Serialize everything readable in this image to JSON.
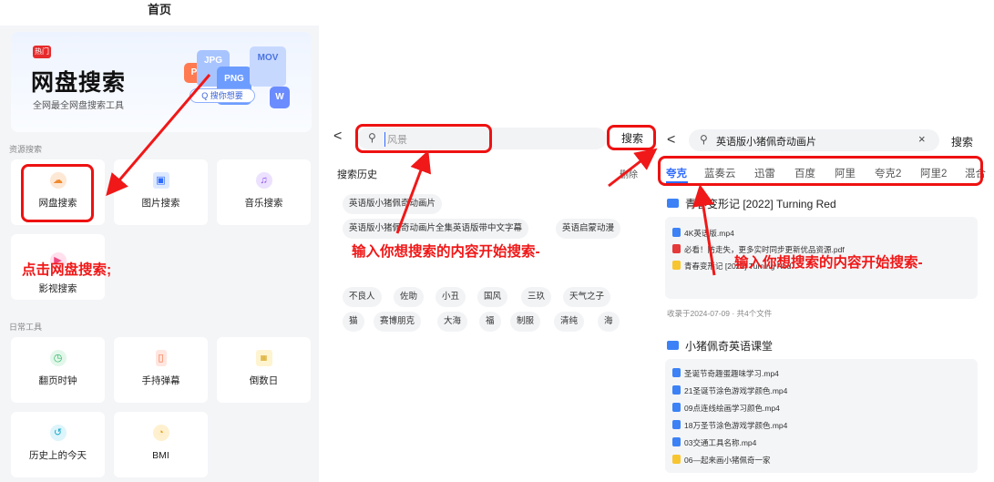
{
  "panel1": {
    "title": "首页",
    "banner": {
      "badge": "热门",
      "title": "网盘搜索",
      "subtitle": "全网最全网盘搜索工具",
      "file_icons": [
        "P",
        "JPG",
        "PNG",
        "MOV",
        "W"
      ],
      "search_chip": "Q 搜你想要"
    },
    "resource_section": "资源搜索",
    "resource_items": [
      {
        "label": "网盘搜索",
        "icon": "cloud-icon"
      },
      {
        "label": "图片搜索",
        "icon": "image-icon"
      },
      {
        "label": "音乐搜索",
        "icon": "music-icon"
      },
      {
        "label": "影视搜索",
        "icon": "video-icon"
      }
    ],
    "tools_section": "日常工具",
    "tool_items": [
      {
        "label": "翻页时钟",
        "icon": "clock-icon"
      },
      {
        "label": "手持弹幕",
        "icon": "phone-icon"
      },
      {
        "label": "倒数日",
        "icon": "calendar-icon"
      },
      {
        "label": "历史上的今天",
        "icon": "history-icon"
      },
      {
        "label": "BMI",
        "icon": "gauge-icon"
      }
    ],
    "annotation": "点击网盘搜索;"
  },
  "panel2": {
    "back": "<",
    "search_placeholder": "风景",
    "search_button": "搜索",
    "history_title": "搜索历史",
    "delete_label": "删除",
    "history": [
      "英语版小猪佩奇动画片",
      "英语版小猪佩奇动画片全集英语版带中文字幕",
      "英语启蒙动漫"
    ],
    "hot_tags": [
      "不良人",
      "佐助",
      "小丑",
      "国风",
      "三玖",
      "天气之子",
      "猫",
      "赛博朋克",
      "大海",
      "福",
      "制服",
      "清纯",
      "海"
    ],
    "annotation": "输入你想搜索的内容开始搜索-"
  },
  "panel3": {
    "back": "<",
    "search_value": "英语版小猪佩奇动画片",
    "clear": "×",
    "search_button": "搜索",
    "tabs": [
      "夸克",
      "蓝奏云",
      "迅雷",
      "百度",
      "阿里",
      "夸克2",
      "阿里2",
      "混合"
    ],
    "result1": {
      "title": "青春变形记 [2022] Turning Red",
      "files": [
        {
          "name": "4K英语版.mp4",
          "type": "video"
        },
        {
          "name": "必看！防走失，更多实时同步更新优品资源.pdf",
          "type": "pdf"
        },
        {
          "name": "青春变形记 [2022] Turning Red",
          "type": "folder"
        }
      ],
      "meta": "收录于2024-07-09 · 共4个文件"
    },
    "result2": {
      "title": "小猪佩奇英语课堂",
      "files": [
        {
          "name": "圣诞节奇趣蛋趣味学习.mp4",
          "type": "video"
        },
        {
          "name": "21圣诞节涂色游戏学颜色.mp4",
          "type": "video"
        },
        {
          "name": "09点连线绘画学习颜色.mp4",
          "type": "video"
        },
        {
          "name": "18万圣节涂色游戏学颜色.mp4",
          "type": "video"
        },
        {
          "name": "03交通工具名称.mp4",
          "type": "video"
        },
        {
          "name": "06—起来画小猪佩奇一家",
          "type": "folder"
        }
      ]
    },
    "annotation": "输入你想搜索的内容开始搜索-"
  },
  "colors": {
    "accent": "#2f6bff",
    "annotation": "#f01818",
    "selected_tab": "#2f6bff"
  }
}
